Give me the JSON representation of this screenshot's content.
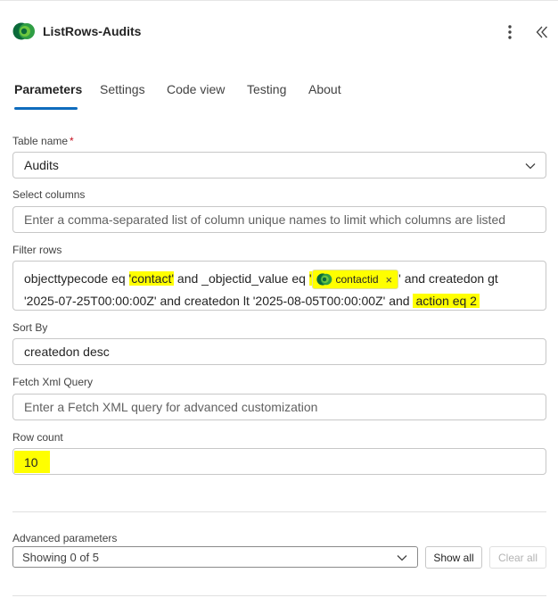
{
  "header": {
    "title": "ListRows-Audits",
    "more_icon": "more-vertical-icon",
    "collapse_icon": "double-chevron-left-icon"
  },
  "tabs": [
    {
      "label": "Parameters",
      "active": true
    },
    {
      "label": "Settings",
      "active": false
    },
    {
      "label": "Code view",
      "active": false
    },
    {
      "label": "Testing",
      "active": false
    },
    {
      "label": "About",
      "active": false
    }
  ],
  "form": {
    "table_name": {
      "label": "Table name",
      "required_mark": "*",
      "value": "Audits"
    },
    "select_columns": {
      "label": "Select columns",
      "placeholder": "Enter a comma-separated list of column unique names to limit which columns are listed"
    },
    "filter_rows": {
      "label": "Filter rows",
      "line1_a": "objecttypecode eq ",
      "line1_hl1": "'contact'",
      "line1_b": " and _objectid_value eq ",
      "line1_quote_open": "'",
      "token_label": "contactid",
      "token_close": "×",
      "line1_c": "' and createdon gt",
      "line2_a": "'2025-07-25T00:00:00Z' and createdon lt '2025-08-05T00:00:00Z' and ",
      "line2_hl": "action eq 2"
    },
    "sort_by": {
      "label": "Sort By",
      "value": "createdon desc"
    },
    "fetch_xml": {
      "label": "Fetch Xml Query",
      "placeholder": "Enter a Fetch XML query for advanced customization"
    },
    "row_count": {
      "label": "Row count",
      "value": "10"
    }
  },
  "advanced": {
    "label": "Advanced parameters",
    "select_value": "Showing 0 of 5",
    "show_all": "Show all",
    "clear_all": "Clear all"
  },
  "colors": {
    "accent": "#0f6cbd",
    "highlight": "#ffff00",
    "logo_dark": "#0b6a3a",
    "logo_light": "#6ec73f"
  }
}
